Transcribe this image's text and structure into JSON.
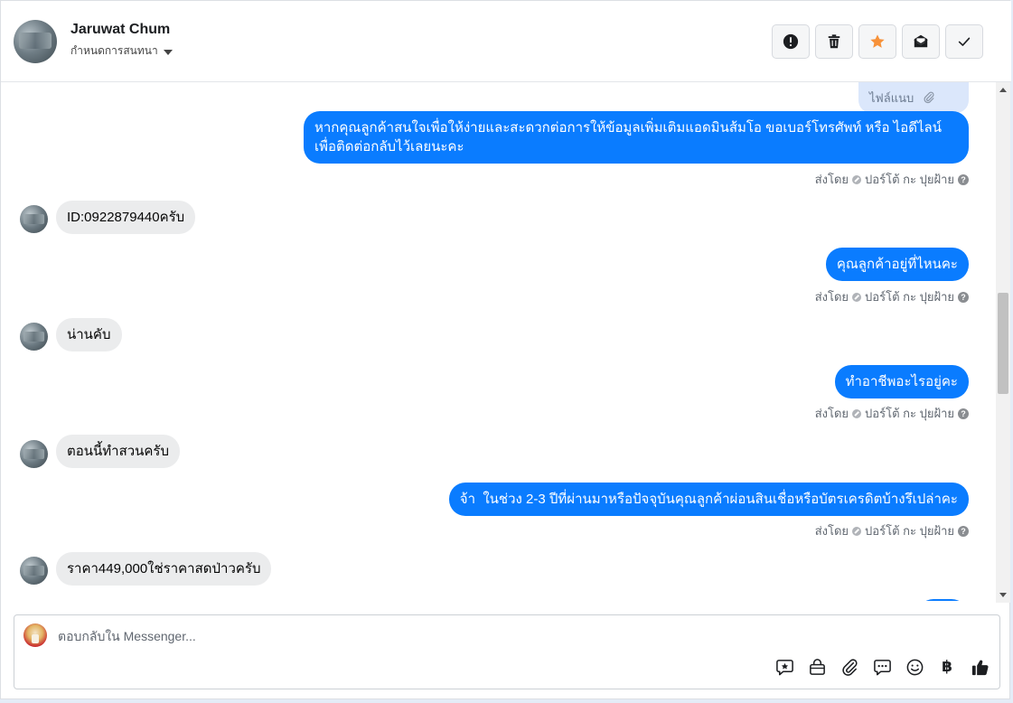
{
  "header": {
    "contact_name": "Jaruwat Chum",
    "assign_label": "กำหนดการสนทนา",
    "actions": [
      {
        "name": "mark-spam-button",
        "icon": "exclamation-icon"
      },
      {
        "name": "delete-button",
        "icon": "trash-icon"
      },
      {
        "name": "star-button",
        "icon": "star-icon"
      },
      {
        "name": "mark-unread-button",
        "icon": "envelope-icon"
      },
      {
        "name": "mark-done-button",
        "icon": "check-icon"
      }
    ]
  },
  "thread": {
    "attachment_label": "ไฟล์แนบ",
    "sent_by_label": "ส่งโดย",
    "sender_name": "ปอร์โต้ กะ ปุยฝ้าย",
    "messages": [
      {
        "direction": "out",
        "text_line1": "หากคุณลูกค้าสนใจเพื่อให้ง่ายและสะดวกต่อการให้ข้อมูลเพิ่มเติมแอดมินส้มโอ ขอเบอร์โทรศัพท์ หรือ ไอดีไลน์",
        "text_line2": "เพื่อติดต่อกลับไว้เลยนะคะ"
      },
      {
        "direction": "in",
        "text": "ID:0922879440ครับ"
      },
      {
        "direction": "out",
        "text": "คุณลูกค้าอยู่ที่ไหนคะ"
      },
      {
        "direction": "in",
        "text": "น่านคับ"
      },
      {
        "direction": "out",
        "text": "ทำอาชีพอะไรอยู่คะ"
      },
      {
        "direction": "in",
        "text": "ตอนนี้ทำสวนครับ"
      },
      {
        "direction": "out",
        "text": "จ้า  ในช่วง 2-3 ปีที่ผ่านมาหรือปัจจุบันคุณลูกค้าผ่อนสินเชื่อหรือบัตรเครดิตบ้างรึเปล่าคะ"
      },
      {
        "direction": "in",
        "text": "ราคา449,000ใช่ราคาสดป่าวครับ"
      }
    ]
  },
  "composer": {
    "placeholder": "ตอบกลับใน Messenger...",
    "currency_symbol": "฿",
    "tools": [
      "message-sticker-icon",
      "shop-bag-icon",
      "paperclip-icon",
      "saved-replies-icon",
      "emoji-icon",
      "baht-icon",
      "thumbs-up-icon"
    ]
  },
  "colors": {
    "outgoing_bubble": "#0a7cff",
    "incoming_bubble": "#ebeced",
    "star_accent": "#f7923a"
  }
}
